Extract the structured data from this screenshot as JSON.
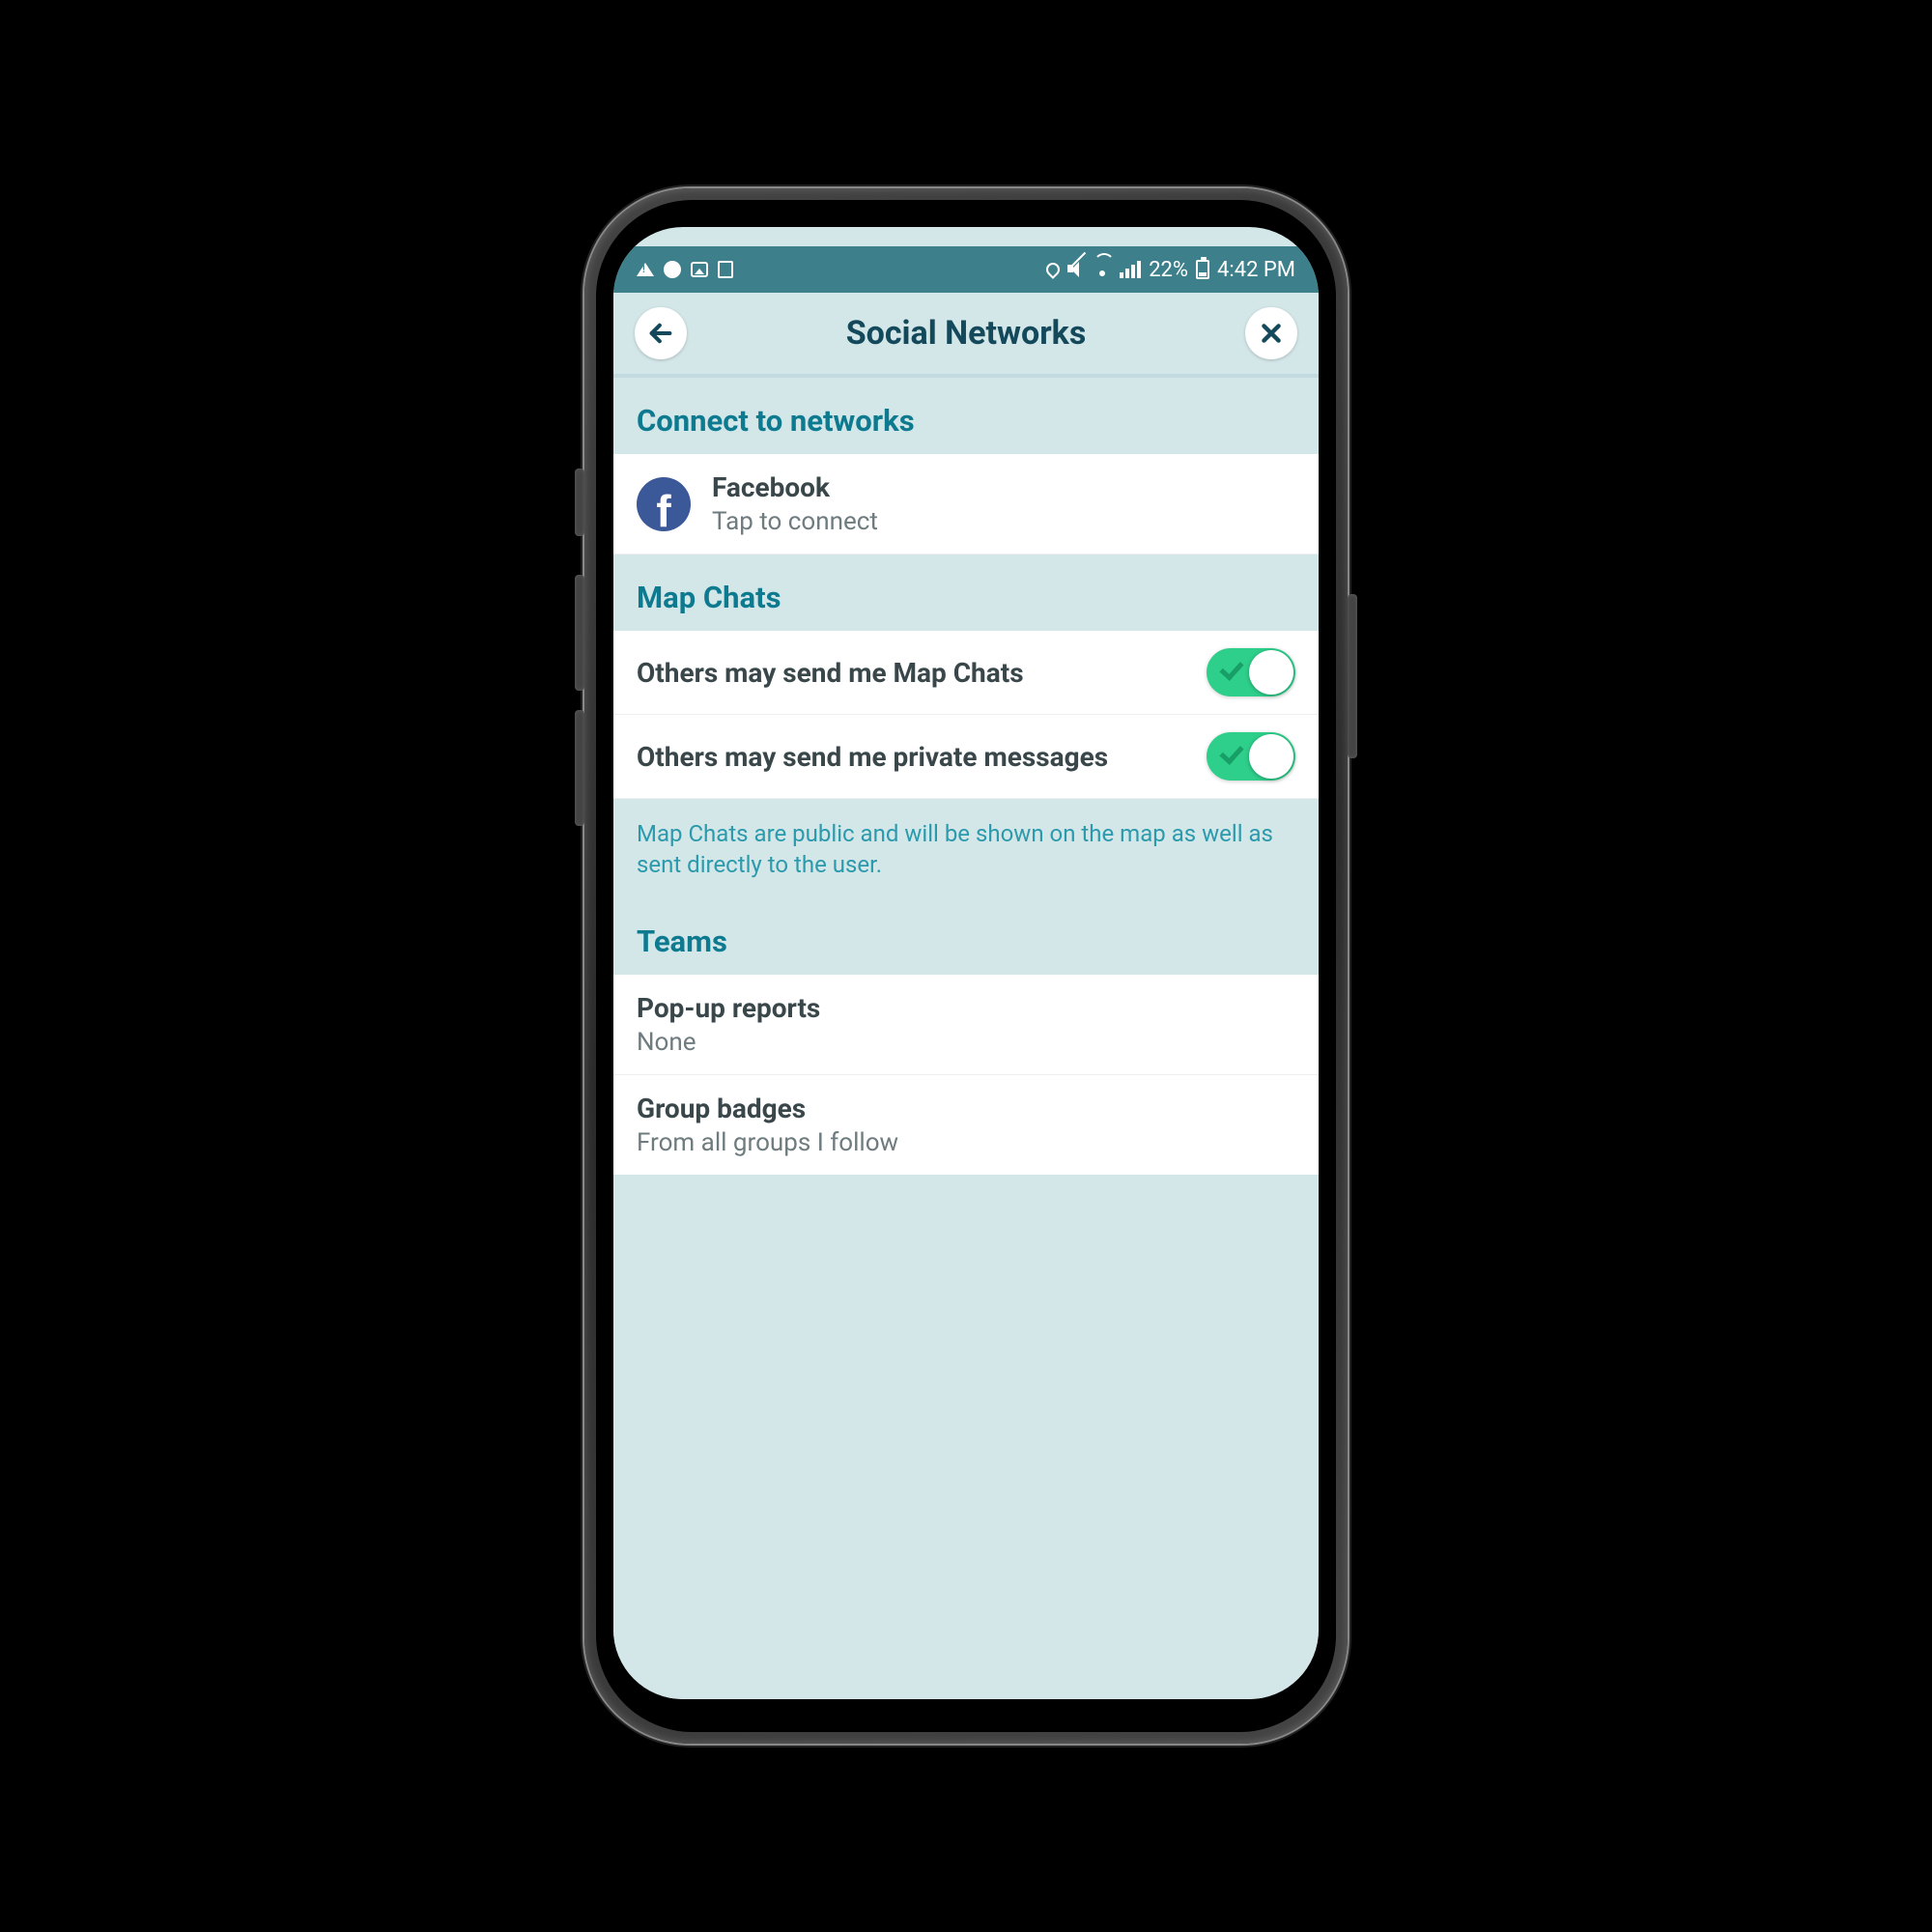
{
  "status_bar": {
    "battery_pct": "22%",
    "time": "4:42 PM",
    "icons_left": [
      "warning",
      "dnd",
      "image",
      "document"
    ],
    "icons_right": [
      "location",
      "mute",
      "wifi-weak",
      "signal"
    ]
  },
  "header": {
    "title": "Social Networks",
    "back_icon": "arrow-back",
    "close_icon": "close-x"
  },
  "sections": {
    "connect": {
      "title": "Connect to networks",
      "items": [
        {
          "icon": "facebook",
          "title": "Facebook",
          "subtitle": "Tap to connect"
        }
      ]
    },
    "mapchats": {
      "title": "Map Chats",
      "toggles": [
        {
          "label": "Others may send me Map Chats",
          "on": true
        },
        {
          "label": "Others may send me private messages",
          "on": true
        }
      ],
      "description": "Map Chats are public and will be shown on the map as well as sent directly to the user."
    },
    "teams": {
      "title": "Teams",
      "items": [
        {
          "title": "Pop-up reports",
          "subtitle": "None"
        },
        {
          "title": "Group badges",
          "subtitle": "From all groups I follow"
        }
      ]
    }
  },
  "colors": {
    "status_bg": "#3d7f8a",
    "page_bg": "#d3e6e8",
    "heading": "#0d7a8f",
    "toggle_on": "#2ecf8b"
  }
}
